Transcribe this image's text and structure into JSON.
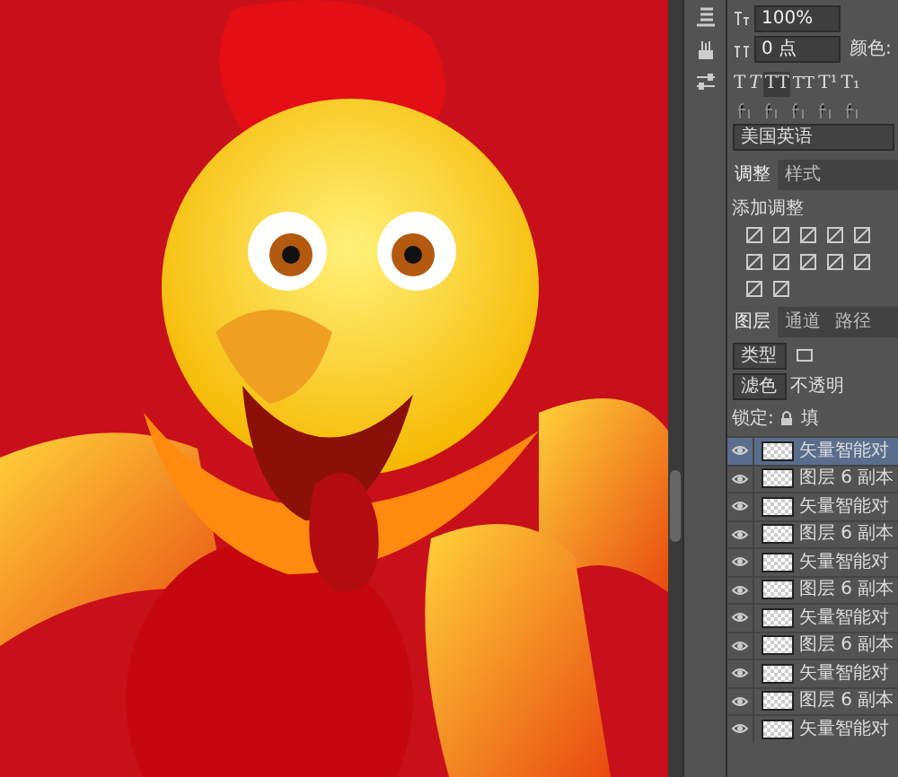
{
  "character_panel": {
    "size_value": "100%",
    "tracking_value": "0 点",
    "color_label": "颜色:",
    "style_buttons": [
      {
        "label": "T",
        "kind": "regular",
        "selected": false
      },
      {
        "label": "T",
        "kind": "italic",
        "selected": false
      },
      {
        "label": "TT",
        "kind": "allcaps",
        "selected": true
      },
      {
        "label": "TT",
        "kind": "smallcaps",
        "selected": false
      },
      {
        "label": "T¹",
        "kind": "super",
        "selected": false
      },
      {
        "label": "T₁",
        "kind": "sub",
        "selected": false
      }
    ],
    "language": "美国英语"
  },
  "adjustments_panel": {
    "tabs": [
      {
        "label": "调整",
        "selected": true
      },
      {
        "label": "样式",
        "selected": false
      }
    ],
    "heading": "添加调整"
  },
  "layers_panel": {
    "tabs": [
      {
        "label": "图层",
        "selected": true
      },
      {
        "label": "通道",
        "selected": false
      },
      {
        "label": "路径",
        "selected": false
      }
    ],
    "filter": "类型",
    "blend_mode": "滤色",
    "opacity_label": "不透明",
    "lock_label": "锁定:",
    "fill_label": "填",
    "layers": [
      {
        "name": "矢量智能对",
        "visible": true,
        "selected": true
      },
      {
        "name": "图层 6 副本",
        "visible": true,
        "selected": false
      },
      {
        "name": "矢量智能对",
        "visible": true,
        "selected": false
      },
      {
        "name": "图层 6 副本",
        "visible": true,
        "selected": false
      },
      {
        "name": "矢量智能对",
        "visible": true,
        "selected": false
      },
      {
        "name": "图层 6 副本",
        "visible": true,
        "selected": false
      },
      {
        "name": "矢量智能对",
        "visible": true,
        "selected": false
      },
      {
        "name": "图层 6 副本",
        "visible": true,
        "selected": false
      },
      {
        "name": "矢量智能对",
        "visible": true,
        "selected": false
      },
      {
        "name": "图层 6 副本",
        "visible": true,
        "selected": false
      },
      {
        "name": "矢量智能对",
        "visible": true,
        "selected": false
      }
    ]
  }
}
